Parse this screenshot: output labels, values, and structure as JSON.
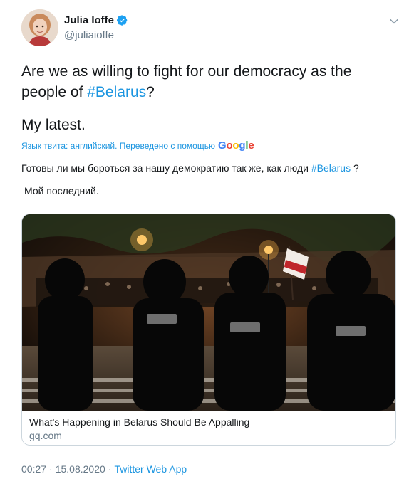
{
  "author": {
    "display_name": "Julia Ioffe",
    "handle": "@juliaioffe",
    "verified": true
  },
  "tweet": {
    "line1_text": "Are we as willing to fight for our democracy as the people of ",
    "line1_hashtag": "#Belarus",
    "line1_end": "?",
    "line2": "My latest."
  },
  "translation": {
    "label": "Язык твита: английский. Переведено с помощью",
    "provider": "Google",
    "line1_text": "Готовы ли мы бороться за нашу демократию так же, как люди ",
    "line1_hashtag": "#Belarus",
    "line1_end": " ?",
    "line2": "Мой последний."
  },
  "card": {
    "title": "What's Happening in Belarus Should Be Appalling",
    "domain": "gq.com",
    "image_alt": "Riot police facing protesters holding a white-red-white flag at night"
  },
  "footer": {
    "time": "00:27",
    "separator1": "·",
    "date": "15.08.2020",
    "separator2": "·",
    "source": "Twitter Web App"
  },
  "colors": {
    "link": "#1b95e0",
    "secondary_text": "#657786",
    "border": "#ccd6dd"
  },
  "icons": [
    "verified-badge-icon",
    "chevron-down-icon",
    "google-logo"
  ]
}
